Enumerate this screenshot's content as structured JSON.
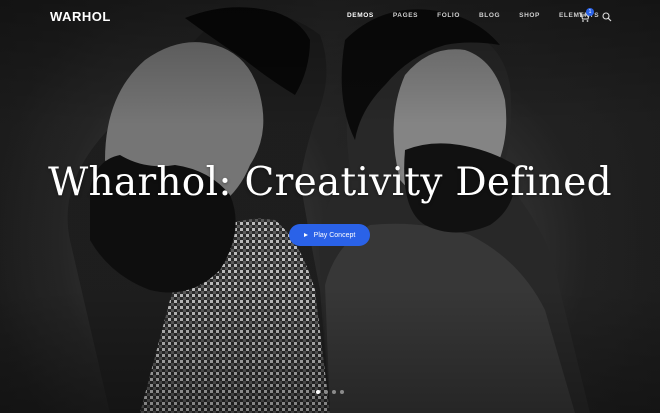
{
  "brand": {
    "logo_text": "WARHOL"
  },
  "nav": {
    "items": [
      {
        "label": "DEMOS",
        "active": true
      },
      {
        "label": "PAGES",
        "active": false
      },
      {
        "label": "FOLIO",
        "active": false
      },
      {
        "label": "BLOG",
        "active": false
      },
      {
        "label": "SHOP",
        "active": false
      },
      {
        "label": "ELEMENTS",
        "active": false
      }
    ],
    "cart_count": "1",
    "icons": {
      "cart": "cart-icon",
      "search": "search-icon"
    }
  },
  "hero": {
    "title": "Wharhol: Creativity Defined",
    "cta_label": "Play Concept",
    "cta_icon": "play-icon",
    "slides": [
      {
        "active": true
      },
      {
        "active": false
      },
      {
        "active": false
      },
      {
        "active": false
      }
    ]
  },
  "colors": {
    "accent": "#2a62e8",
    "text": "#ffffff",
    "background": "#1a1a1a"
  }
}
